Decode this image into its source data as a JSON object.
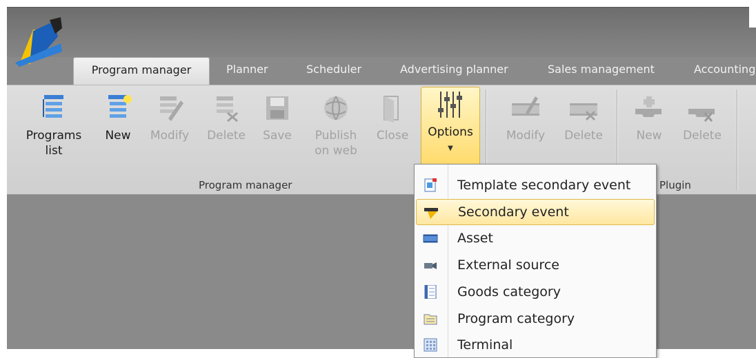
{
  "tabs": [
    "Program manager",
    "Planner",
    "Scheduler",
    "Advertising planner",
    "Sales management",
    "Accounting"
  ],
  "ribbon": {
    "buttons": [
      {
        "label": "Programs",
        "label2": "list",
        "icon": "programs-list-icon"
      },
      {
        "label": "New",
        "label2": "",
        "icon": "new-program-icon"
      },
      {
        "label": "Modify",
        "label2": "",
        "icon": "modify-icon"
      },
      {
        "label": "Delete",
        "label2": "",
        "icon": "delete-icon"
      },
      {
        "label": "Save",
        "label2": "",
        "icon": "save-icon"
      },
      {
        "label": "Publish",
        "label2": "on web",
        "icon": "globe-icon"
      },
      {
        "label": "Close",
        "label2": "",
        "icon": "close-icon"
      },
      {
        "label": "Options",
        "label2": "",
        "icon": "sliders-icon"
      },
      {
        "label": "Modify",
        "label2": "",
        "icon": "film-modify-icon"
      },
      {
        "label": "Delete",
        "label2": "",
        "icon": "film-delete-icon"
      },
      {
        "label": "New",
        "label2": "",
        "icon": "plugin-new-icon"
      },
      {
        "label": "Delete",
        "label2": "",
        "icon": "plugin-delete-icon"
      }
    ],
    "groups": {
      "program_manager": "Program manager",
      "plugin": "Plugin"
    }
  },
  "menu": {
    "items": [
      {
        "label": "Template secondary event",
        "icon": "template-icon"
      },
      {
        "label": "Secondary event",
        "icon": "secondary-event-icon"
      },
      {
        "label": "Asset",
        "icon": "asset-icon"
      },
      {
        "label": "External source",
        "icon": "camera-icon"
      },
      {
        "label": "Goods category",
        "icon": "list-icon"
      },
      {
        "label": "Program category",
        "icon": "folder-icon"
      },
      {
        "label": "Terminal",
        "icon": "terminal-icon"
      }
    ]
  },
  "colors": {
    "accent": "#ffd966",
    "frame": "#8a8a8a",
    "ribbon": "#d8d8d8"
  }
}
